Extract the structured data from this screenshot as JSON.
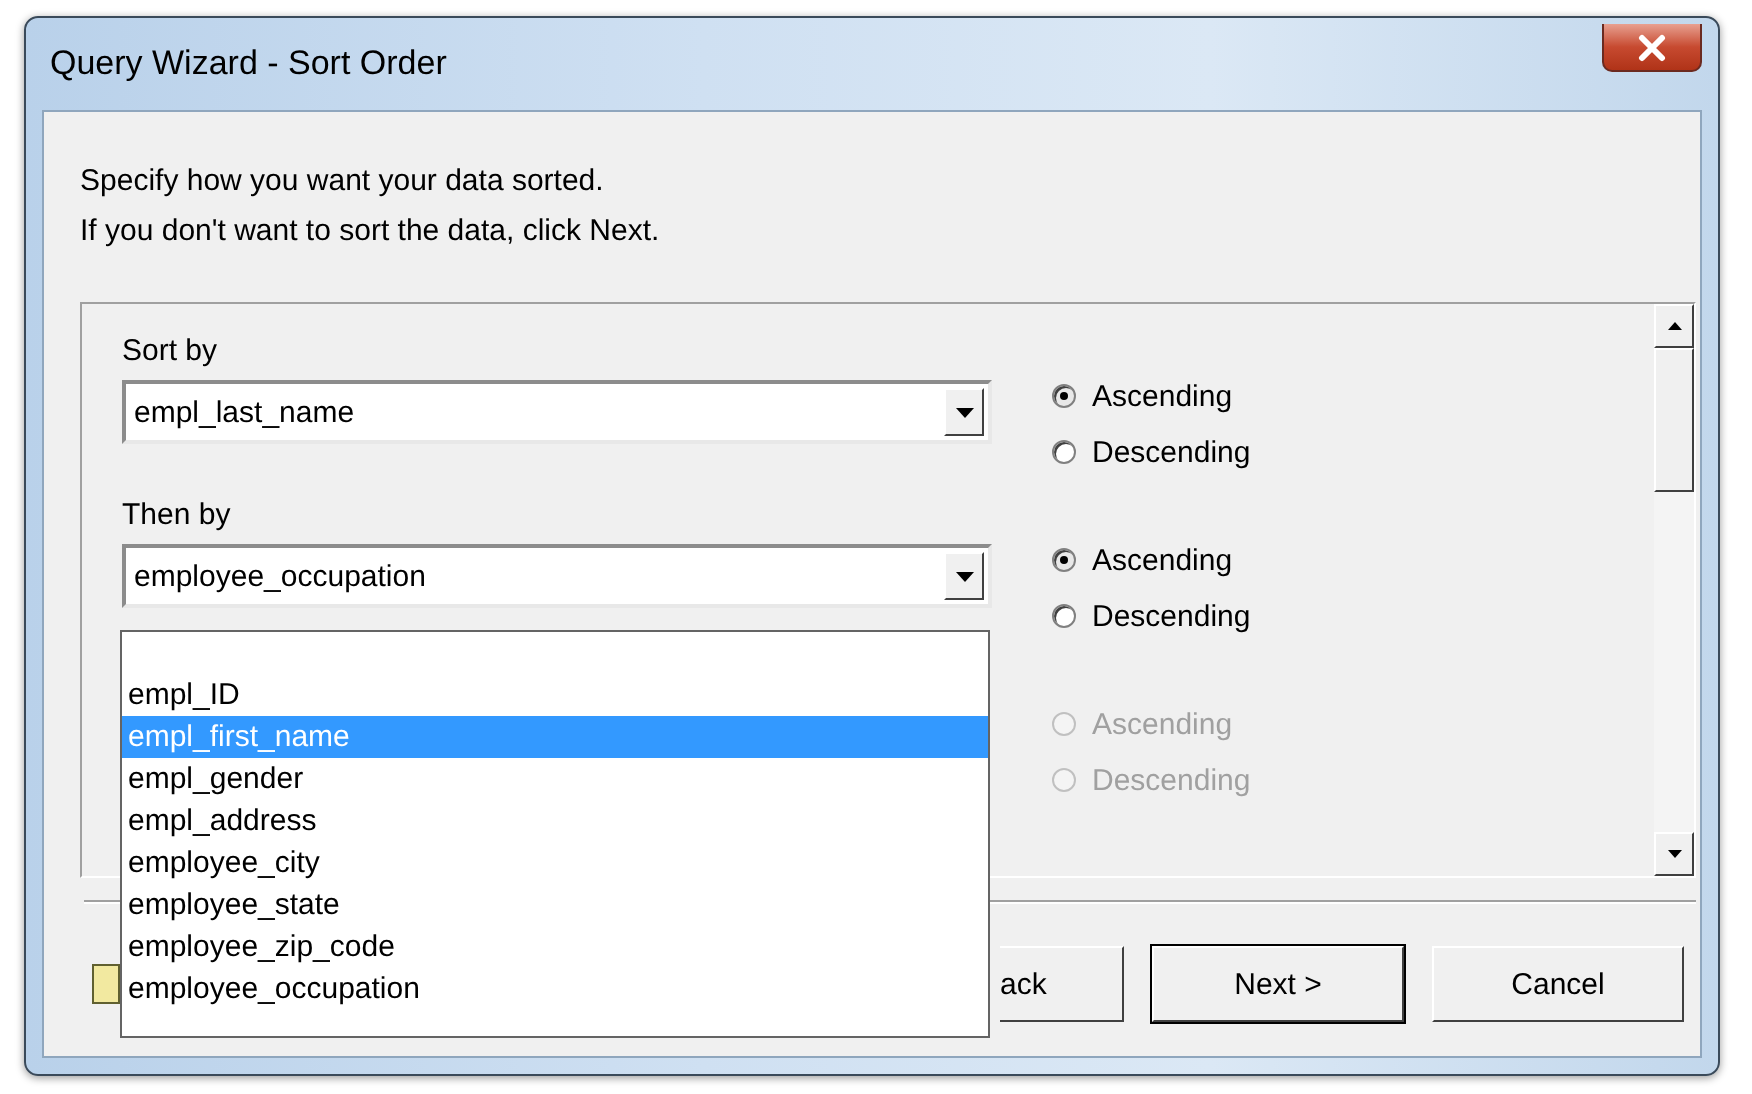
{
  "window": {
    "title": "Query Wizard - Sort Order"
  },
  "instructions": [
    "Specify how you want your data sorted.",
    "If you don't want to sort the data, click Next."
  ],
  "sort_rows": [
    {
      "label": "Sort by",
      "value": "empl_last_name",
      "disabled": false,
      "options": [
        {
          "label": "Ascending",
          "selected": true
        },
        {
          "label": "Descending",
          "selected": false
        }
      ]
    },
    {
      "label": "Then by",
      "value": "employee_occupation",
      "disabled": false,
      "options": [
        {
          "label": "Ascending",
          "selected": true
        },
        {
          "label": "Descending",
          "selected": false
        }
      ]
    },
    {
      "disabled": true,
      "options": [
        {
          "label": "Ascending",
          "selected": false
        },
        {
          "label": "Descending",
          "selected": false
        }
      ]
    }
  ],
  "dropdown": {
    "items": [
      {
        "label": "empl_ID",
        "selected": false
      },
      {
        "label": "empl_first_name",
        "selected": true
      },
      {
        "label": "empl_gender",
        "selected": false
      },
      {
        "label": "empl_address",
        "selected": false
      },
      {
        "label": "employee_city",
        "selected": false
      },
      {
        "label": "employee_state",
        "selected": false
      },
      {
        "label": "employee_zip_code",
        "selected": false
      },
      {
        "label": "employee_occupation",
        "selected": false
      }
    ]
  },
  "buttons": [
    {
      "label": "ack",
      "kind": "partial",
      "default": false
    },
    {
      "label": "Next >",
      "kind": "normal",
      "default": true
    },
    {
      "label": "Cancel",
      "kind": "normal",
      "default": false
    }
  ]
}
